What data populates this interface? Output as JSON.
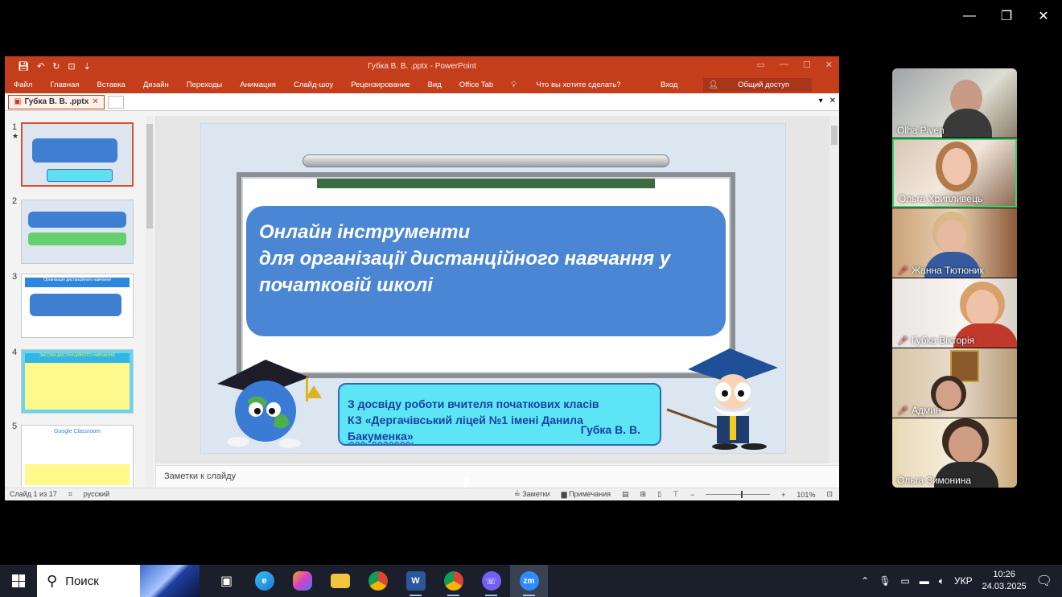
{
  "zoom_window": {
    "minimize": "—",
    "restore": "❐",
    "close": "✕"
  },
  "powerpoint": {
    "title": "Губка В. В. .pptx - PowerPoint",
    "ribbon_tabs": [
      "Файл",
      "Главная",
      "Вставка",
      "Дизайн",
      "Переходы",
      "Анимация",
      "Слайд-шоу",
      "Рецензирование",
      "Вид",
      "Office Tab"
    ],
    "tell_me": "Что вы хотите сделать?",
    "sign_in": "Вход",
    "share": "Общий доступ",
    "doc_tab": "Губка В. В. .pptx",
    "thumb_numbers": [
      "1",
      "2",
      "3",
      "4",
      "5"
    ],
    "thumb3_header": "Організація дистанційного навчання",
    "thumb4_header": "ЗАСОБИ ДИСТАНЦІЙНОГО НАВЧАННЯ",
    "thumb5_header": "Google Classroom",
    "slide": {
      "title_lines": [
        "Онлайн інструменти",
        "для організації дистанційного навчання у",
        "початковій школі"
      ],
      "info_line1": "З досвіду роботи вчителя початкових класів",
      "info_line2": "КЗ «Дергачівський ліцей №1 імені Данила",
      "info_line3": "Бакуменка»",
      "author": "Губка В. В."
    },
    "notes_placeholder": "Заметки к слайду",
    "status": {
      "slide_counter": "Слайд 1 из 17",
      "language": "русский",
      "notes_btn": "Заметки",
      "comments_btn": "Примечания",
      "zoom": "101%"
    }
  },
  "participants": [
    {
      "name": "Olha Piven",
      "muted": false
    },
    {
      "name": "Ольга Хрипливець",
      "muted": false,
      "active": true
    },
    {
      "name": "Жанна Тютюник",
      "muted": true
    },
    {
      "name": "Губка Вікторія",
      "muted": true
    },
    {
      "name": "Админ",
      "muted": true
    },
    {
      "name": "Ольга Зимонина",
      "muted": false
    }
  ],
  "taskbar": {
    "search_placeholder": "Поиск",
    "language": "УКР",
    "time": "10:26",
    "date": "24.03.2025"
  },
  "colors": {
    "ppt_accent": "#c43e1c",
    "slide_title_bg": "#4a86d4",
    "info_box_bg": "#5ce5f4",
    "active_speaker": "#3ad26c"
  }
}
